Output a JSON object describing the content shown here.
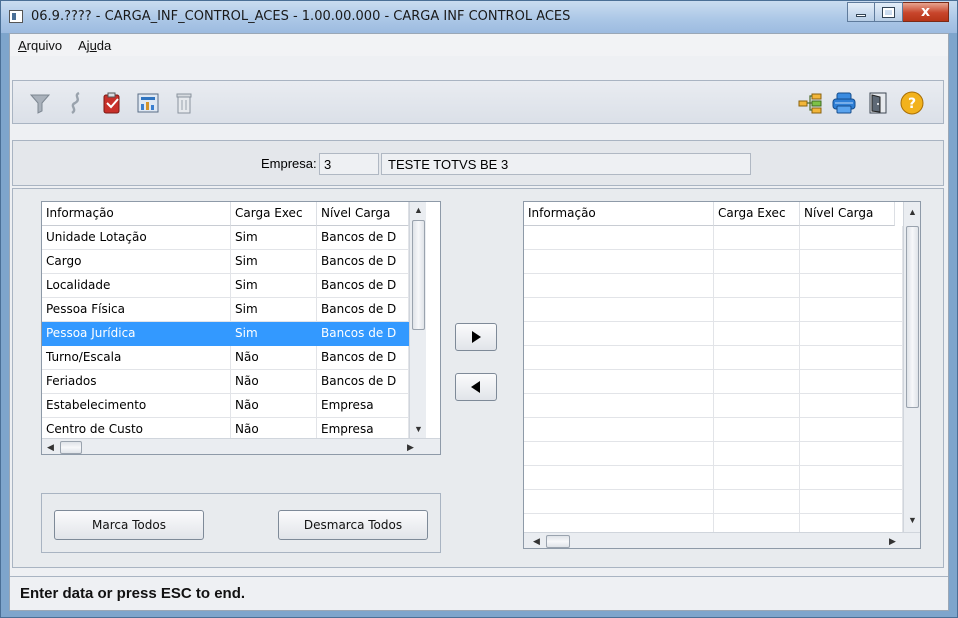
{
  "window": {
    "title": "06.9.???? - CARGA_INF_CONTROL_ACES - 1.00.00.000 - CARGA INF CONTROL ACES",
    "close_glyph": "x"
  },
  "menu": {
    "arquivo_first": "A",
    "arquivo_rest": "rquivo",
    "ajuda_first": "Aj",
    "ajuda_u": "u",
    "ajuda_rest": "da"
  },
  "toolbar": {
    "left_icons": [
      "filter-icon",
      "hook-icon",
      "clipboard-icon",
      "chart-icon",
      "trash-icon"
    ],
    "right_icons": [
      "tree-icon",
      "print-icon",
      "exit-door-icon",
      "help-icon"
    ]
  },
  "empresa": {
    "label": "Empresa:",
    "code": "3",
    "name": "TESTE TOTVS BE 3"
  },
  "left_grid": {
    "headers": [
      "Informação",
      "Carga Exec",
      "Nível Carga"
    ],
    "rows": [
      [
        "Unidade Lotação",
        "Sim",
        "Bancos de D"
      ],
      [
        "Cargo",
        "Sim",
        "Bancos de D"
      ],
      [
        "Localidade",
        "Sim",
        "Bancos de D"
      ],
      [
        "Pessoa Física",
        "Sim",
        "Bancos de D"
      ],
      [
        "Pessoa Jurídica",
        "Sim",
        "Bancos de D"
      ],
      [
        "Turno/Escala",
        "Não",
        "Bancos de D"
      ],
      [
        "Feriados",
        "Não",
        "Bancos de D"
      ],
      [
        "Estabelecimento",
        "Não",
        "Empresa"
      ],
      [
        "Centro de Custo",
        "Não",
        "Empresa"
      ]
    ],
    "selected_row_index": 4
  },
  "right_grid": {
    "headers": [
      "Informação",
      "Carga Exec",
      "Nível Carga"
    ]
  },
  "buttons": {
    "marca_todos": "Marca Todos",
    "desmarca_todos": "Desmarca Todos"
  },
  "status": {
    "text": "Enter data or press ESC to end."
  },
  "colors": {
    "selection": "#3399ff",
    "title_bar": "#aac6e6",
    "close_button": "#c8452b"
  }
}
